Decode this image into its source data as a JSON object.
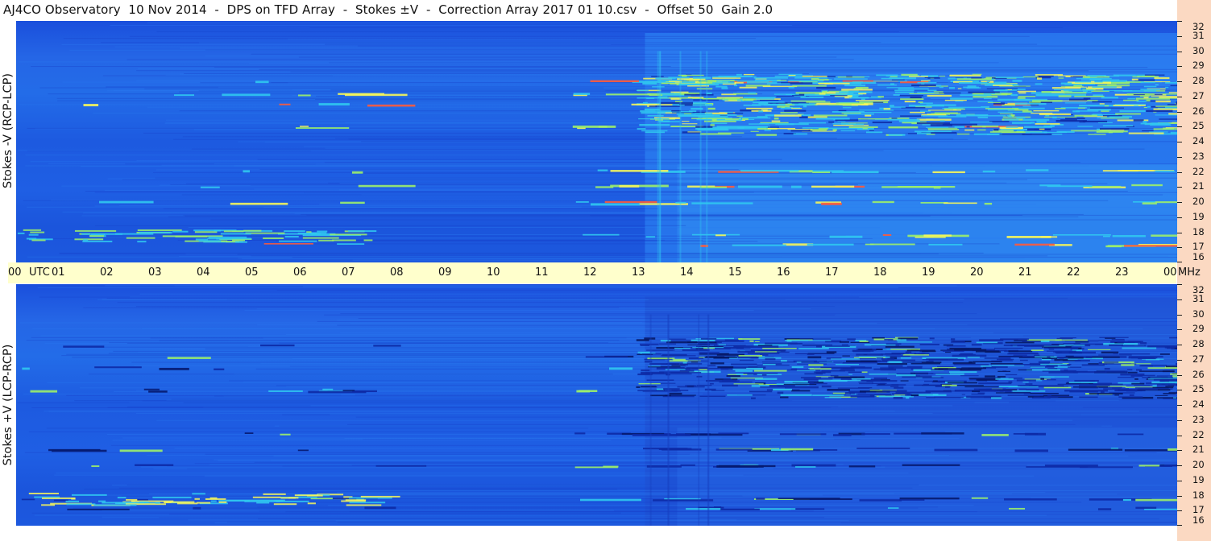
{
  "title": "AJ4CO Observatory  10 Nov 2014  -  DPS on TFD Array  -  Stokes ±V  -  Correction Array 2017 01 10.csv  -  Offset 50  Gain 2.0",
  "chart_data": [
    {
      "type": "heatmap",
      "panel": "top",
      "ylabel": "Stokes -V (RCP-LCP)",
      "x_ticks": [
        "00",
        "01",
        "02",
        "03",
        "04",
        "05",
        "06",
        "07",
        "08",
        "09",
        "10",
        "11",
        "12",
        "13",
        "14",
        "15",
        "16",
        "17",
        "18",
        "19",
        "20",
        "21",
        "22",
        "23",
        "00"
      ],
      "x_unit_label": "UTC",
      "y_ticks": [
        16,
        17,
        18,
        19,
        20,
        21,
        22,
        23,
        24,
        25,
        26,
        27,
        28,
        29,
        30,
        31,
        32
      ],
      "y_unit_label": "MHz",
      "xlim": [
        0,
        24
      ],
      "ylim": [
        16,
        32
      ],
      "colormap": [
        "#0d2aa6",
        "#1f5fe8",
        "#2f8df7",
        "#30c8f0",
        "#9cf06a",
        "#f6f65a",
        "#ff5a3a"
      ],
      "background_level": "#1f5fe8",
      "activity_window_utc": [
        12.0,
        24.0
      ],
      "interference_bands_mhz": [
        17.2,
        17.8,
        20.0,
        21.1,
        22.1,
        25.0,
        26.5,
        27.2,
        28.0
      ],
      "sign": "positive"
    },
    {
      "type": "heatmap",
      "panel": "bottom",
      "ylabel": "Stokes +V (LCP-RCP)",
      "x_ticks": [
        "00",
        "01",
        "02",
        "03",
        "04",
        "05",
        "06",
        "07",
        "08",
        "09",
        "10",
        "11",
        "12",
        "13",
        "14",
        "15",
        "16",
        "17",
        "18",
        "19",
        "20",
        "21",
        "22",
        "23",
        "00"
      ],
      "x_unit_label": "UTC",
      "y_ticks": [
        16,
        17,
        18,
        19,
        20,
        21,
        22,
        23,
        24,
        25,
        26,
        27,
        28,
        29,
        30,
        31,
        32
      ],
      "y_unit_label": "MHz",
      "xlim": [
        0,
        24
      ],
      "ylim": [
        16,
        32
      ],
      "colormap": [
        "#0d2aa6",
        "#1f5fe8",
        "#2f8df7",
        "#30c8f0",
        "#9cf06a",
        "#f6f65a",
        "#ff5a3a"
      ],
      "background_level": "#1f5fe8",
      "activity_window_utc": [
        12.0,
        24.0
      ],
      "interference_bands_mhz": [
        17.2,
        17.8,
        20.0,
        21.1,
        22.1,
        25.0,
        26.5,
        27.2,
        28.0
      ],
      "sign": "negative"
    }
  ]
}
